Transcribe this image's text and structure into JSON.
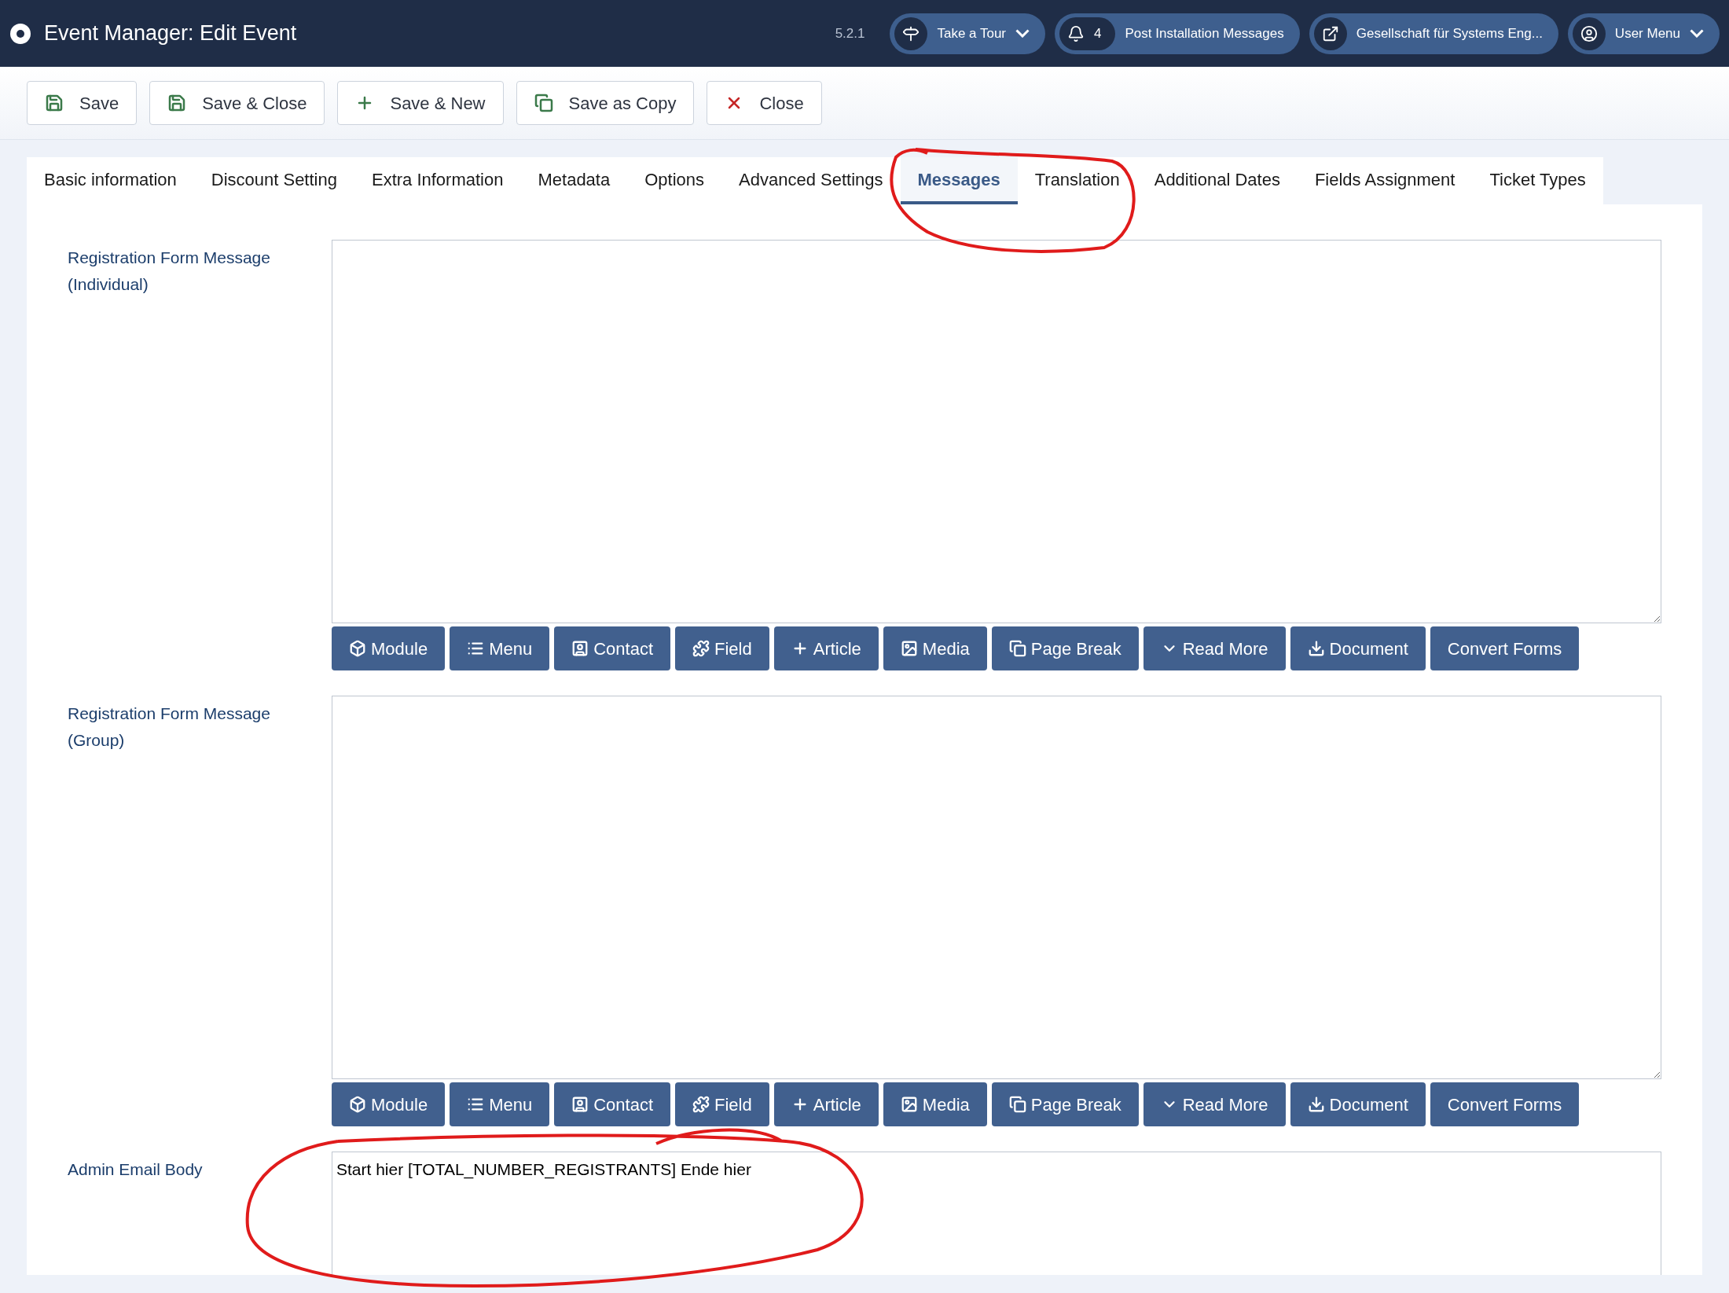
{
  "header": {
    "title": "Event Manager: Edit Event",
    "version": "5.2.1",
    "pills": [
      {
        "kind": "dropdown",
        "label": "Take a Tour"
      },
      {
        "kind": "count",
        "count": "4",
        "label": "Post Installation Messages"
      },
      {
        "kind": "link",
        "label": "Gesellschaft für Systems Eng..."
      },
      {
        "kind": "dropdown",
        "label": "User Menu"
      }
    ]
  },
  "toolbar": [
    {
      "label": "Save"
    },
    {
      "label": "Save & Close"
    },
    {
      "label": "Save & New"
    },
    {
      "label": "Save as Copy"
    },
    {
      "label": "Close"
    }
  ],
  "tabs": [
    {
      "label": "Basic information",
      "selected": false
    },
    {
      "label": "Discount Setting",
      "selected": false
    },
    {
      "label": "Extra Information",
      "selected": false
    },
    {
      "label": "Metadata",
      "selected": false
    },
    {
      "label": "Options",
      "selected": false
    },
    {
      "label": "Advanced Settings",
      "selected": false
    },
    {
      "label": "Messages",
      "selected": true
    },
    {
      "label": "Translation",
      "selected": false
    },
    {
      "label": "Additional Dates",
      "selected": false
    },
    {
      "label": "Fields Assignment",
      "selected": false
    },
    {
      "label": "Ticket Types",
      "selected": false
    }
  ],
  "fields": [
    {
      "label": "Registration Form Message (Individual)",
      "editor_buttons": [
        "Module",
        "Menu",
        "Contact",
        "Field",
        "Article",
        "Media",
        "Page Break",
        "Read More",
        "Document",
        "Convert Forms"
      ]
    },
    {
      "label": "Registration Form Message (Group)",
      "editor_buttons": [
        "Module",
        "Menu",
        "Contact",
        "Field",
        "Article",
        "Media",
        "Page Break",
        "Read More",
        "Document",
        "Convert Forms"
      ]
    },
    {
      "label": "Admin Email Body",
      "value": "Start hier [TOTAL_NUMBER_REGISTRANTS] Ende hier"
    }
  ]
}
